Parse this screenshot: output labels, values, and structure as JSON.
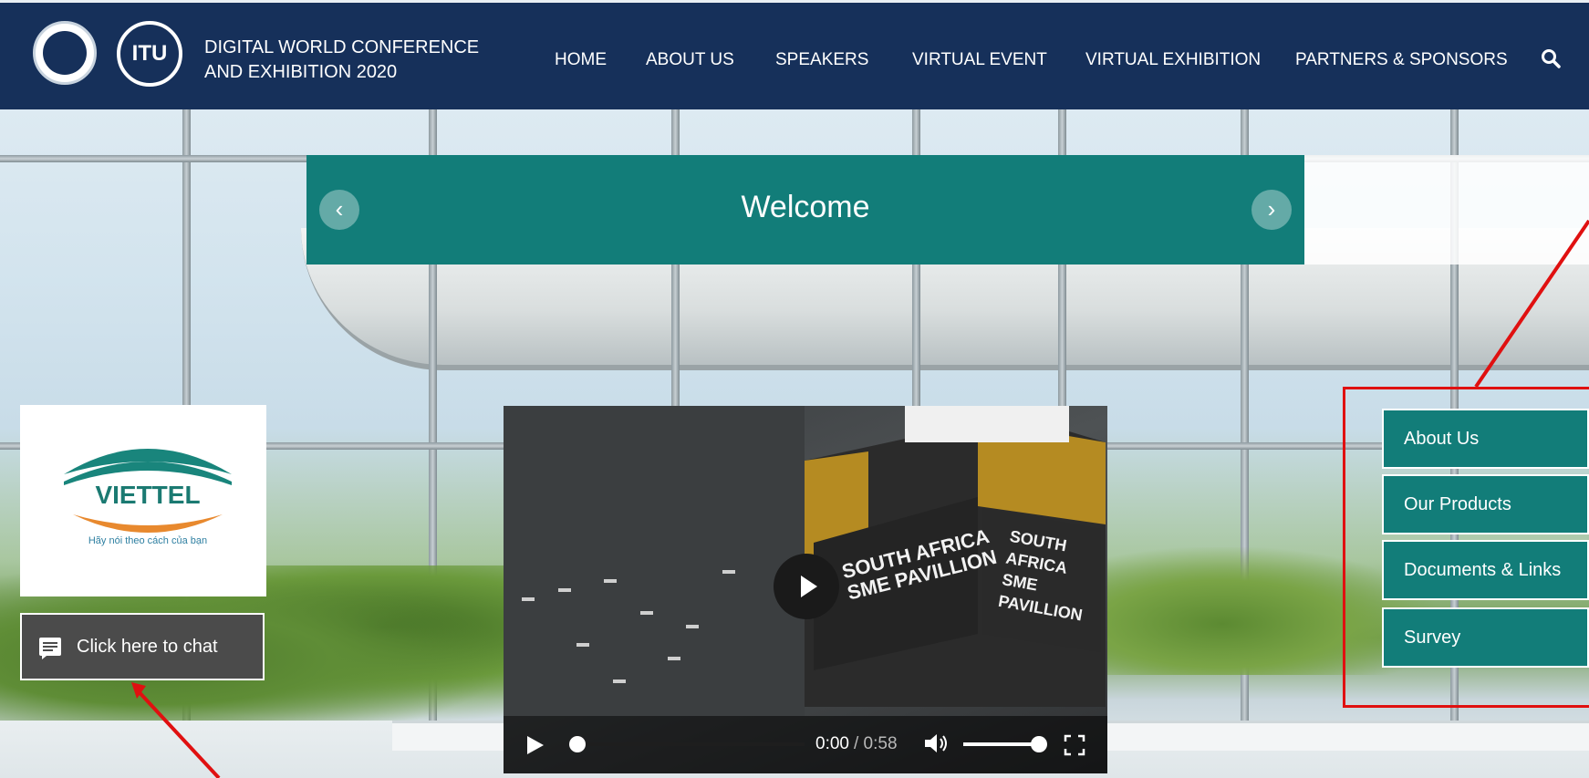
{
  "header": {
    "brand_line1": "DIGITAL WORLD CONFERENCE",
    "brand_line2": "AND EXHIBITION 2020",
    "logo_text": "ITU",
    "nav": [
      "HOME",
      "ABOUT US",
      "SPEAKERS",
      "VIRTUAL EVENT",
      "VIRTUAL EXHIBITION",
      "PARTNERS & SPONSORS"
    ]
  },
  "banner": {
    "title": "Welcome",
    "prev_icon": "‹",
    "next_icon": "›"
  },
  "exhibitor": {
    "logo_text": "VIETTEL",
    "tagline": "Hãy nói theo cách của bạn"
  },
  "chat": {
    "label": "Click here to chat"
  },
  "video": {
    "booth_line1": "SOUTH AFRICA",
    "booth_line2": "SME PAVILLION",
    "current_time": "0:00",
    "duration": "/ 0:58",
    "progress": 0.0,
    "volume": 0.95
  },
  "side_menu": [
    "About Us",
    "Our Products",
    "Documents & Links",
    "Survey"
  ],
  "colors": {
    "header_bg": "#16305a",
    "teal": "#127d79",
    "annotation_red": "#e01010"
  }
}
